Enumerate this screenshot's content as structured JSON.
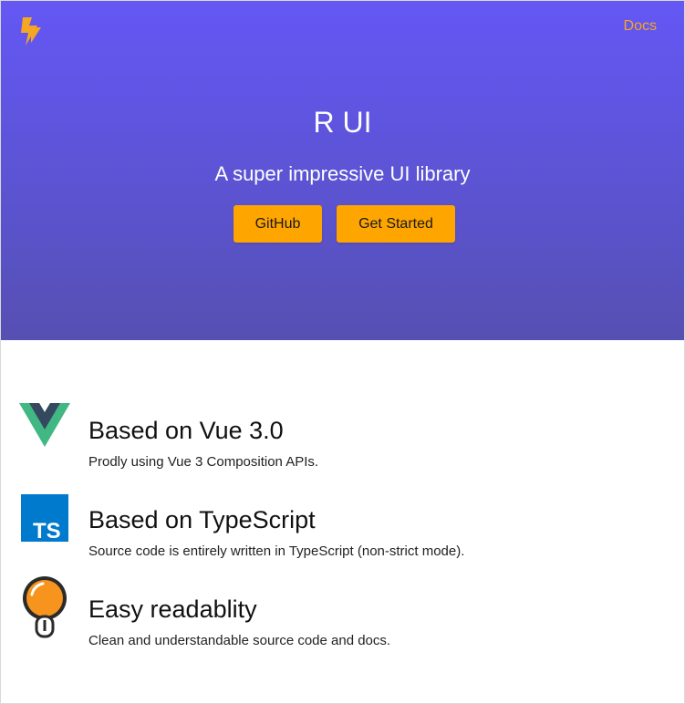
{
  "nav": {
    "docs_label": "Docs"
  },
  "hero": {
    "title": "R UI",
    "subtitle": "A super impressive UI library",
    "buttons": {
      "github": "GitHub",
      "get_started": "Get Started"
    }
  },
  "features": [
    {
      "icon": "vue-logo-icon",
      "title": "Based on Vue 3.0",
      "description": "Prodly using Vue 3 Composition APIs."
    },
    {
      "icon": "typescript-logo-icon",
      "title": "Based on TypeScript",
      "description": "Source code is entirely written in TypeScript (non-strict mode)."
    },
    {
      "icon": "light-bulb-icon",
      "title": "Easy readablity",
      "description": "Clean and understandable source code and docs."
    }
  ],
  "colors": {
    "hero_top": "#6457f5",
    "hero_bottom": "#5650b2",
    "accent": "#ffa500",
    "docs_link": "#f5a623"
  }
}
